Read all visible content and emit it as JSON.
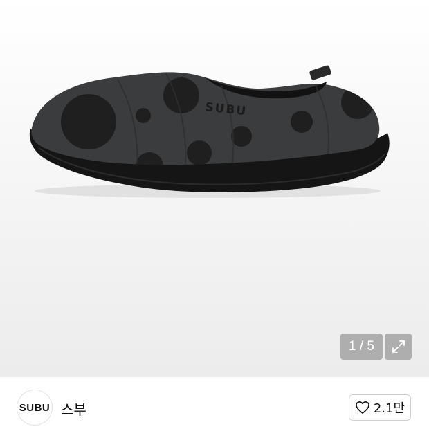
{
  "gallery": {
    "current_page": "1",
    "separator": "/",
    "total_pages": "5",
    "counter_text": "1 / 5",
    "product_brand_print": "SUBU",
    "expand_icon": "expand-arrows-icon"
  },
  "seller": {
    "avatar_text": "SUBU",
    "name": "스부"
  },
  "like": {
    "icon": "heart-icon",
    "count": "2.1만"
  },
  "colors": {
    "shoe_body": "#3a3b3d",
    "shoe_dots": "#1c1c1c",
    "sole": "#141414",
    "overlay": "#969696"
  }
}
